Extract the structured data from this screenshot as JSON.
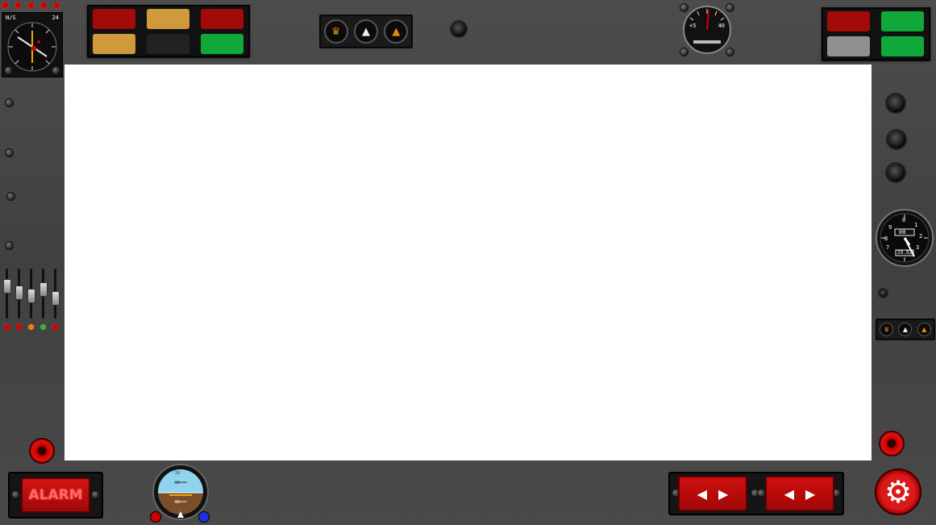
{
  "alarm": {
    "label": "ALARM"
  },
  "settings": {
    "icon": "gear-icon"
  },
  "top_left_leds": [
    "red",
    "red",
    "red",
    "red",
    "red"
  ],
  "annunciator_left": {
    "lamps": [
      {
        "color": "#a30a0a"
      },
      {
        "color": "#cf9a3c"
      },
      {
        "color": "#a30a0a"
      },
      {
        "color": "#cf9a3c"
      },
      {
        "color": "#222222"
      },
      {
        "color": "#10a83a"
      }
    ]
  },
  "annunciator_right": {
    "lamps": [
      {
        "color": "#a30a0a"
      },
      {
        "color": "#10a83a"
      },
      {
        "color": "#909090"
      },
      {
        "color": "#10a83a"
      }
    ]
  },
  "mode_icons": [
    "crown-icon",
    "compass-needle-icon",
    "arrow-up-icon"
  ],
  "slider_levels": [
    0.72,
    0.55,
    0.45,
    0.62,
    0.4
  ],
  "slider_leds": [
    "#d10000",
    "#d10000",
    "#e58a00",
    "#18c040",
    "#d10000"
  ],
  "heading_gauge": {
    "top_left": "N/S",
    "top_right": "24"
  },
  "vsi_gauge": {
    "left": "+5",
    "right": "40"
  },
  "altimeter": {
    "numbers": [
      "0",
      "1",
      "2",
      "3",
      "4",
      "5",
      "6",
      "7",
      "8",
      "9"
    ],
    "counter": "00",
    "window": "29.92"
  },
  "attitude": {
    "marks": [
      "10",
      "10",
      "10"
    ]
  },
  "nav_buttons": [
    {
      "left": "◀",
      "right": "▶"
    },
    {
      "left": "◀",
      "right": "▶"
    }
  ]
}
